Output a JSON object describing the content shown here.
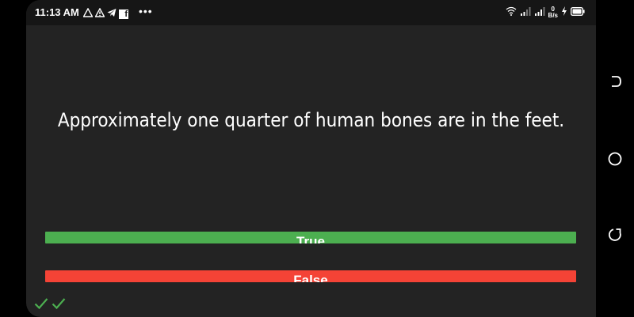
{
  "status_bar": {
    "time": "11:13 AM",
    "notification_icons": [
      "warning-outline-icon",
      "warning-icon",
      "telegram-icon",
      "facebook-icon"
    ],
    "more_label": "•••",
    "net_speed_value": "0",
    "net_speed_unit": "B/s",
    "system_icons": [
      "wifi-icon",
      "signal-icon",
      "signal-icon",
      "net-speed",
      "charging-icon",
      "battery-icon"
    ]
  },
  "quiz": {
    "question": "Approximately one quarter of human bones are in the feet.",
    "answers": [
      {
        "label": "True",
        "color": "#4caf50"
      },
      {
        "label": "False",
        "color": "#f44336"
      }
    ],
    "score_marks": [
      "check-icon",
      "check-icon"
    ],
    "score_color": "#4caf50"
  },
  "nav_bar": {
    "buttons": [
      "back-icon",
      "home-icon",
      "recents-icon"
    ]
  },
  "colors": {
    "background": "#232323",
    "status_bar": "#161616",
    "text": "#ffffff"
  }
}
